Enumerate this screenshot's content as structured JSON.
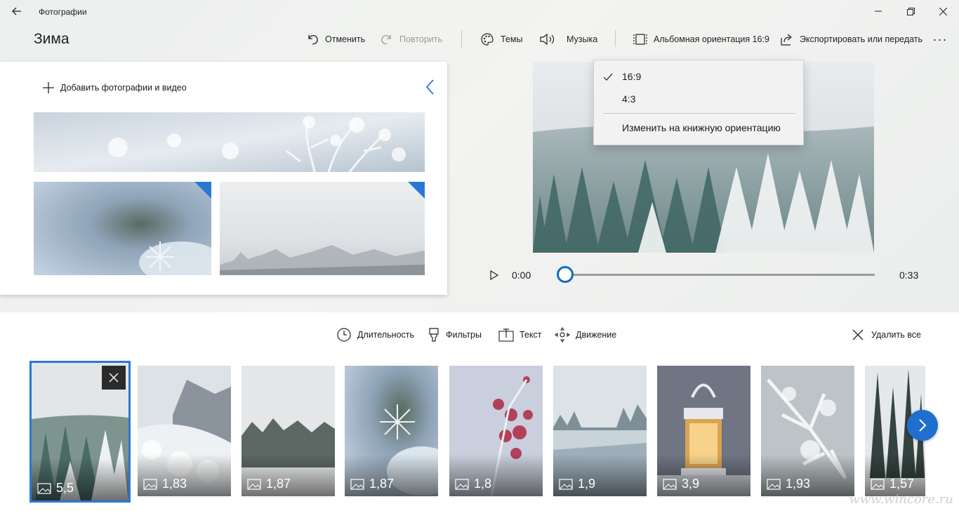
{
  "window": {
    "title": "Фотографии"
  },
  "project": {
    "title": "Зима"
  },
  "toolbar": {
    "undo": "Отменить",
    "redo": "Повторить",
    "themes": "Темы",
    "music": "Музыка",
    "aspect": "Альбомная ориентация 16:9",
    "export": "Экспортировать или передать",
    "more": "···"
  },
  "library": {
    "add_label": "Добавить фотографии и видео"
  },
  "player": {
    "current_time": "0:00",
    "total_time": "0:33",
    "progress": 0
  },
  "aspect_menu": {
    "items": [
      {
        "label": "16:9",
        "checked": true
      },
      {
        "label": "4:3",
        "checked": false
      },
      {
        "label": "Изменить на книжную ориентацию",
        "checked": false
      }
    ]
  },
  "storyboard": {
    "duration": "Длительность",
    "filters": "Фильтры",
    "text": "Текст",
    "motion": "Движение",
    "remove_all": "Удалить все",
    "clips": [
      {
        "duration": "5,5",
        "selected": true
      },
      {
        "duration": "1,83"
      },
      {
        "duration": "1,87"
      },
      {
        "duration": "1,87"
      },
      {
        "duration": "1,8"
      },
      {
        "duration": "1,9"
      },
      {
        "duration": "3,9"
      },
      {
        "duration": "1,93"
      },
      {
        "duration": "1,57"
      }
    ]
  },
  "watermark": "www.wincore.ru",
  "colors": {
    "accent": "#2b78d4",
    "next_button": "#1f6fd1",
    "selection": "#0f6cbd"
  }
}
